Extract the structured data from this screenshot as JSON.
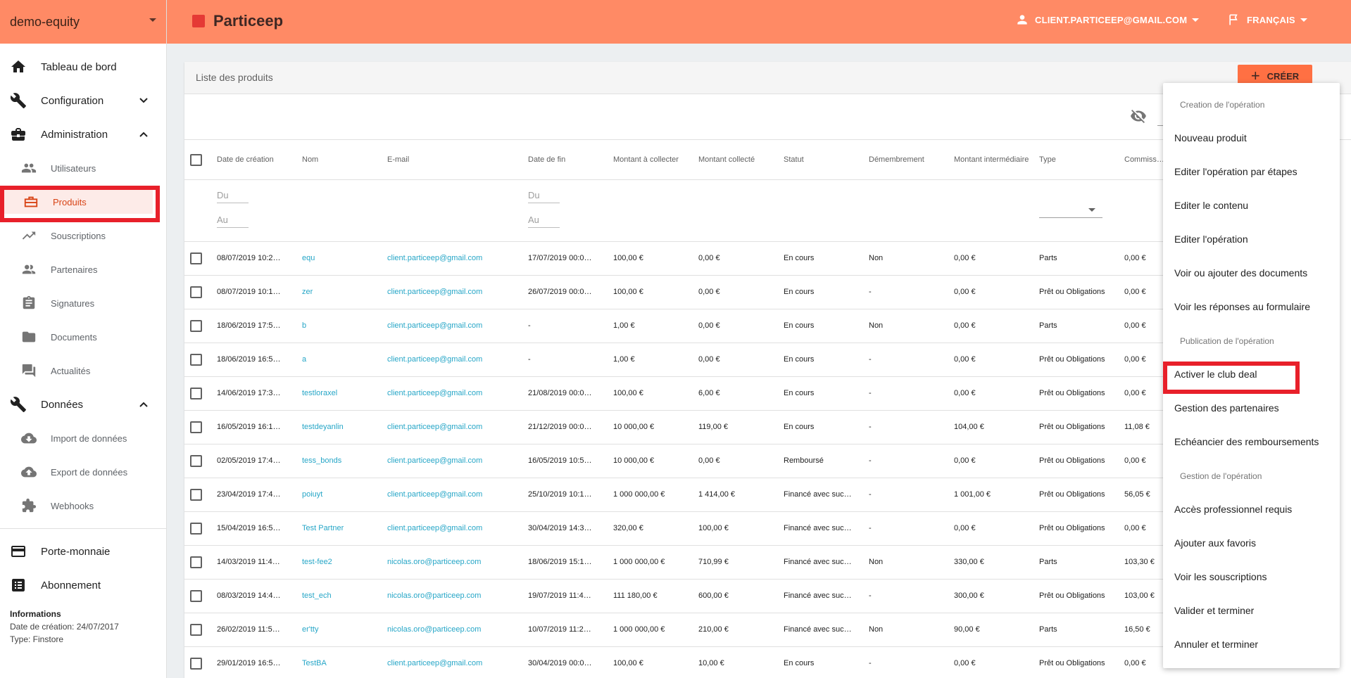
{
  "org": {
    "name": "demo-equity"
  },
  "brand": {
    "name": "Particeep"
  },
  "header": {
    "user_email": "CLIENT.PARTICEEP@GMAIL.COM",
    "language": "FRANÇAIS"
  },
  "sidebar": {
    "main_items": [
      {
        "label": "Tableau de bord",
        "icon": "home-icon"
      },
      {
        "label": "Configuration",
        "icon": "wrench-icon"
      },
      {
        "label": "Administration",
        "icon": "briefcase-icon"
      }
    ],
    "admin_items": [
      {
        "label": "Utilisateurs",
        "icon": "users-icon"
      },
      {
        "label": "Produits",
        "icon": "briefcase-icon"
      },
      {
        "label": "Souscriptions",
        "icon": "trending-icon"
      },
      {
        "label": "Partenaires",
        "icon": "partners-icon"
      },
      {
        "label": "Signatures",
        "icon": "clipboard-icon"
      },
      {
        "label": "Documents",
        "icon": "folder-icon"
      },
      {
        "label": "Actualités",
        "icon": "comment-icon"
      }
    ],
    "data_section": {
      "label": "Données",
      "icon": "wrench-icon"
    },
    "data_items": [
      {
        "label": "Import de données",
        "icon": "cloud-download-icon"
      },
      {
        "label": "Export de données",
        "icon": "cloud-upload-icon"
      },
      {
        "label": "Webhooks",
        "icon": "puzzle-icon"
      }
    ],
    "bottom_items": [
      {
        "label": "Porte-monnaie",
        "icon": "card-icon"
      },
      {
        "label": "Abonnement",
        "icon": "list-icon"
      }
    ],
    "info": {
      "title": "Informations",
      "created": "Date de création: 24/07/2017",
      "type": "Type: Finstore"
    }
  },
  "products": {
    "title": "Liste des produits",
    "create_label": "CRÉER",
    "columns": [
      "Date de création",
      "Nom",
      "E-mail",
      "Date de fin",
      "Montant à collecter",
      "Montant collecté",
      "Statut",
      "Démembrement",
      "Montant intermédiaire",
      "Type",
      "Commission"
    ],
    "filters": {
      "from": "Du",
      "to": "Au"
    },
    "rows": [
      {
        "date": "08/07/2019 10:2…",
        "name": "equ",
        "email": "client.particeep@gmail.com",
        "end": "17/07/2019 00:0…",
        "target": "100,00 €",
        "collected": "0,00 €",
        "status": "En cours",
        "dismember": "Non",
        "intermediate": "0,00 €",
        "type": "Parts",
        "commission": "0,00 €"
      },
      {
        "date": "08/07/2019 10:1…",
        "name": "zer",
        "email": "client.particeep@gmail.com",
        "end": "26/07/2019 00:0…",
        "target": "100,00 €",
        "collected": "0,00 €",
        "status": "En cours",
        "dismember": "-",
        "intermediate": "0,00 €",
        "type": "Prêt ou Obligations",
        "commission": "0,00 €"
      },
      {
        "date": "18/06/2019 17:5…",
        "name": "b",
        "email": "client.particeep@gmail.com",
        "end": "-",
        "target": "1,00 €",
        "collected": "0,00 €",
        "status": "En cours",
        "dismember": "Non",
        "intermediate": "0,00 €",
        "type": "Parts",
        "commission": "0,00 €"
      },
      {
        "date": "18/06/2019 16:5…",
        "name": "a",
        "email": "client.particeep@gmail.com",
        "end": "-",
        "target": "1,00 €",
        "collected": "0,00 €",
        "status": "En cours",
        "dismember": "-",
        "intermediate": "0,00 €",
        "type": "Prêt ou Obligations",
        "commission": "0,00 €"
      },
      {
        "date": "14/06/2019 17:3…",
        "name": "testloraxel",
        "email": "client.particeep@gmail.com",
        "end": "21/08/2019 00:0…",
        "target": "100,00 €",
        "collected": "6,00 €",
        "status": "En cours",
        "dismember": "-",
        "intermediate": "0,00 €",
        "type": "Prêt ou Obligations",
        "commission": "0,00 €"
      },
      {
        "date": "16/05/2019 16:1…",
        "name": "testdeyanlin",
        "email": "client.particeep@gmail.com",
        "end": "21/12/2019 00:0…",
        "target": "10 000,00 €",
        "collected": "119,00 €",
        "status": "En cours",
        "dismember": "-",
        "intermediate": "104,00 €",
        "type": "Prêt ou Obligations",
        "commission": "11,08 €"
      },
      {
        "date": "02/05/2019 17:4…",
        "name": "tess_bonds",
        "email": "client.particeep@gmail.com",
        "end": "16/05/2019 10:5…",
        "target": "10 000,00 €",
        "collected": "0,00 €",
        "status": "Remboursé",
        "dismember": "-",
        "intermediate": "0,00 €",
        "type": "Prêt ou Obligations",
        "commission": "0,00 €"
      },
      {
        "date": "23/04/2019 17:4…",
        "name": "poiuyt",
        "email": "client.particeep@gmail.com",
        "end": "25/10/2019 10:1…",
        "target": "1 000 000,00 €",
        "collected": "1 414,00 €",
        "status": "Financé avec suc…",
        "dismember": "-",
        "intermediate": "1 001,00 €",
        "type": "Prêt ou Obligations",
        "commission": "56,05 €"
      },
      {
        "date": "15/04/2019 16:5…",
        "name": "Test Partner",
        "email": "client.particeep@gmail.com",
        "end": "30/04/2019 14:3…",
        "target": "320,00 €",
        "collected": "100,00 €",
        "status": "Financé avec suc…",
        "dismember": "-",
        "intermediate": "0,00 €",
        "type": "Prêt ou Obligations",
        "commission": "0,00 €"
      },
      {
        "date": "14/03/2019 11:4…",
        "name": "test-fee2",
        "email": "nicolas.oro@particeep.com",
        "end": "18/06/2019 15:1…",
        "target": "1 000 000,00 €",
        "collected": "710,99 €",
        "status": "Financé avec suc…",
        "dismember": "Non",
        "intermediate": "330,00 €",
        "type": "Parts",
        "commission": "103,30 €"
      },
      {
        "date": "08/03/2019 14:4…",
        "name": "test_ech",
        "email": "nicolas.oro@particeep.com",
        "end": "19/07/2019 11:4…",
        "target": "111 180,00 €",
        "collected": "600,00 €",
        "status": "Financé avec suc…",
        "dismember": "-",
        "intermediate": "300,00 €",
        "type": "Prêt ou Obligations",
        "commission": "103,00 €"
      },
      {
        "date": "26/02/2019 11:5…",
        "name": "er'tty",
        "email": "nicolas.oro@particeep.com",
        "end": "10/07/2019 11:2…",
        "target": "1 000 000,00 €",
        "collected": "210,00 €",
        "status": "Financé avec suc…",
        "dismember": "Non",
        "intermediate": "90,00 €",
        "type": "Parts",
        "commission": "16,50 €"
      },
      {
        "date": "29/01/2019 16:5…",
        "name": "TestBA",
        "email": "client.particeep@gmail.com",
        "end": "30/04/2019 00:0…",
        "target": "100,00 €",
        "collected": "10,00 €",
        "status": "En cours",
        "dismember": "-",
        "intermediate": "0,00 €",
        "type": "Prêt ou Obligations",
        "commission": "0,00 €"
      }
    ]
  },
  "menu": {
    "sections": [
      {
        "header": "Creation de l'opération",
        "items": [
          "Nouveau produit",
          "Editer l'opération par étapes",
          "Editer le contenu",
          "Editer l'opération",
          "Voir ou ajouter des documents",
          "Voir les réponses au formulaire"
        ]
      },
      {
        "header": "Publication de l'opération",
        "items": [
          "Activer le club deal",
          "Gestion des partenaires",
          "Echéancier des remboursements"
        ]
      },
      {
        "header": "Gestion de l'opération",
        "items": [
          "Accès professionnel requis",
          "Ajouter aux favoris",
          "Voir les souscriptions",
          "Valider et terminer",
          "Annuler et terminer"
        ]
      }
    ]
  }
}
